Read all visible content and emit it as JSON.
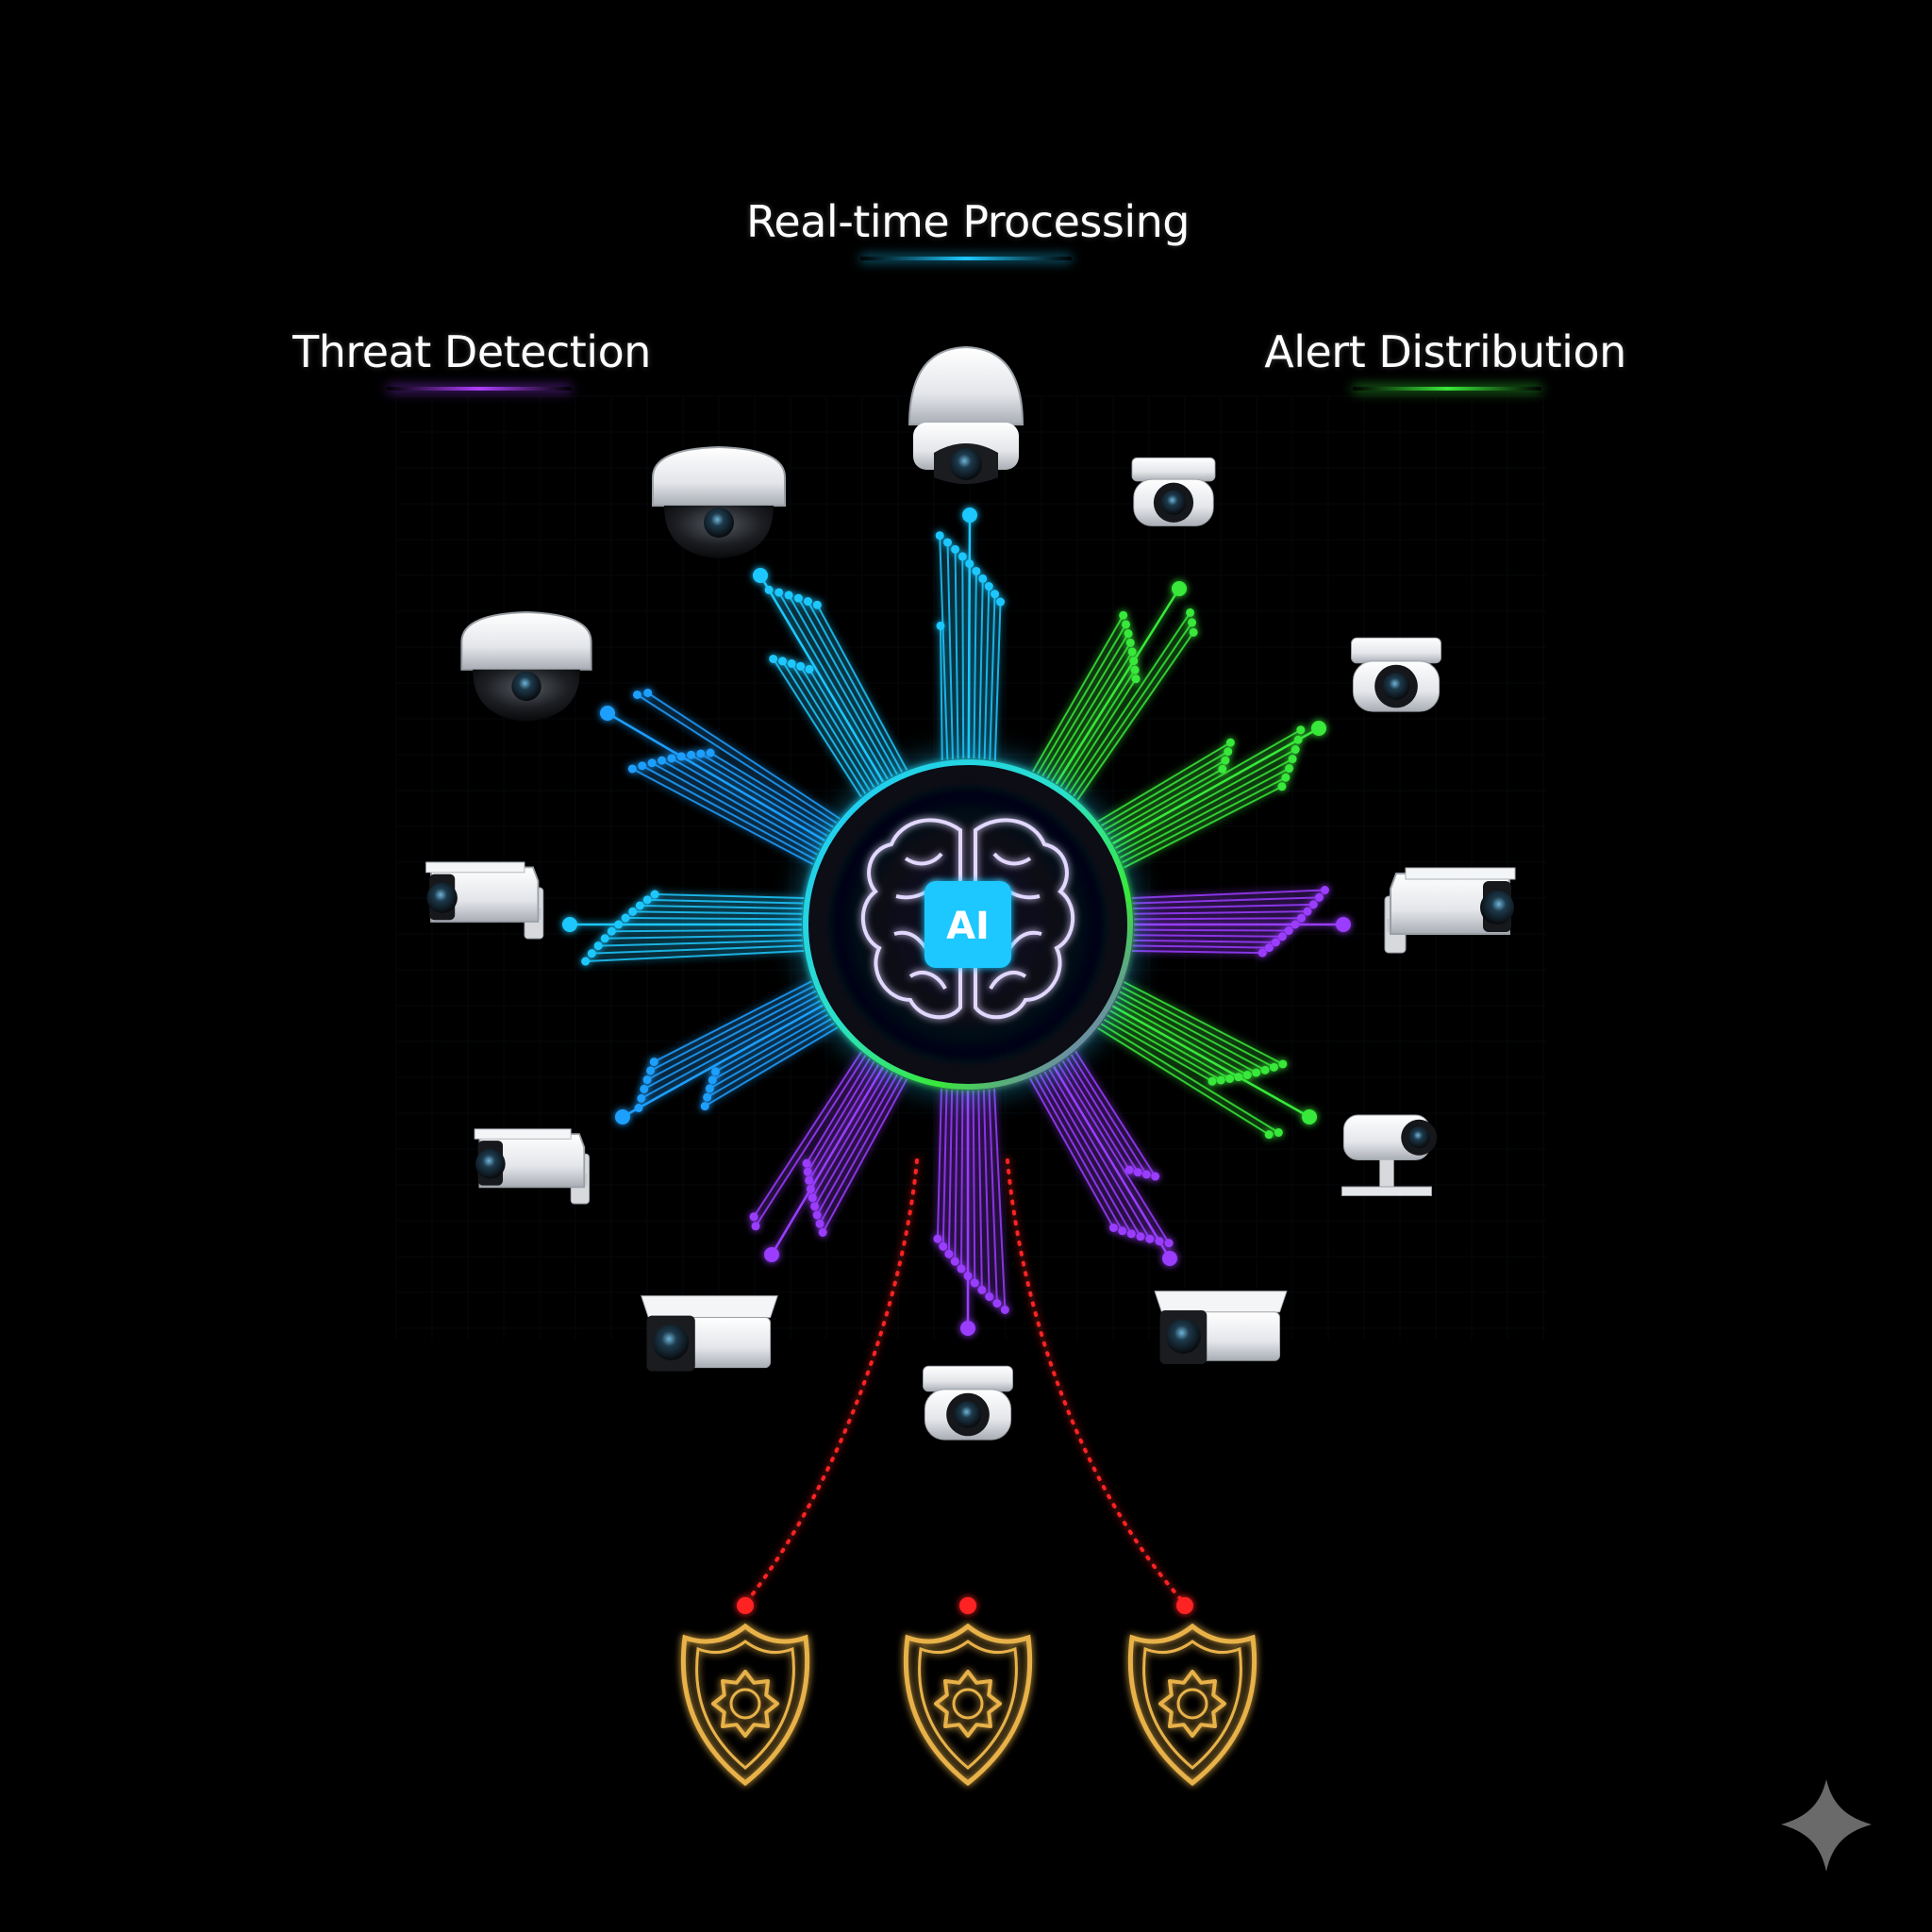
{
  "labels": {
    "realtime": "Real-time Processing",
    "threat": "Threat Detection",
    "alert": "Alert Distribution"
  },
  "hub": {
    "text": "AI"
  },
  "colors": {
    "background": "#000000",
    "cyan": "#1ec8ff",
    "blue": "#1f9fff",
    "green": "#39e83a",
    "purple": "#9a3cff",
    "alert_red": "#ff2020",
    "shield_gold": "#e8b24a",
    "hub_glow": "#22c8ff"
  },
  "icons": [
    "brain-icon",
    "camera-icon",
    "shield-badge-icon",
    "sparkle-icon"
  ]
}
